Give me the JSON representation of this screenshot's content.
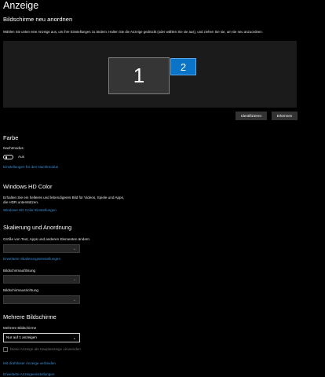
{
  "page": {
    "title": "Anzeige"
  },
  "rearrange": {
    "heading": "Bildschirme neu anordnen",
    "description": "Wählen Sie unten eine Anzeige aus, um ihre Einstellungen zu ändern. Halten Sie die Anzeige gedrückt (oder wählen Sie sie aus), und ziehen Sie sie, um sie neu anzuordnen.",
    "monitor_1": "1",
    "monitor_2": "2",
    "identify_button": "Identifizieren",
    "detect_button": "Erkennen"
  },
  "color": {
    "heading": "Farbe",
    "night_mode_label": "Nachtmodus",
    "night_mode_state": "Aus",
    "night_mode_link": "Einstellungen für den Nachtmodus"
  },
  "hdr": {
    "heading": "Windows HD Color",
    "description": "Erhalten Sie ein helleres und lebendigeres Bild für Videos, Spiele und Apps, die HDR unterstützen.",
    "link": "Windows HD Color-Einstellungen"
  },
  "scale": {
    "heading": "Skalierung und Anordnung",
    "size_label": "Größe von Text, Apps und anderen Elementen ändern",
    "size_value": "",
    "advanced_link": "Erweiterte Skalierungseinstellungen",
    "resolution_label": "Bildschirmauflösung",
    "resolution_value": "",
    "orientation_label": "Bildschirmausrichtung",
    "orientation_value": ""
  },
  "multi": {
    "heading": "Mehrere Bildschirme",
    "label": "Mehrere Bildschirme",
    "selected": "Nur auf 1 anzeigen",
    "checkbox_label": "Diese Anzeige als Hauptanzeige verwenden",
    "wireless_link": "Mit drahtloser Anzeige verbinden",
    "advanced_link": "Erweiterte Anzeigeeinstellungen"
  }
}
